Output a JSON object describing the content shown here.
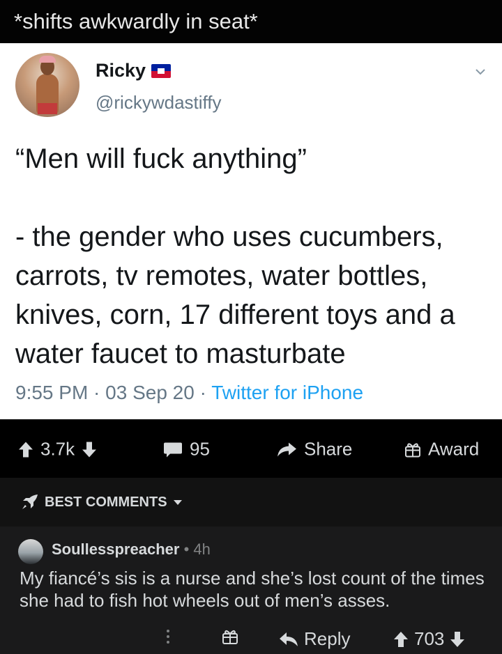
{
  "post": {
    "title": "*shifts awkwardly in seat*"
  },
  "tweet": {
    "name": "Ricky",
    "handle": "@rickywdastiffy",
    "text": "“Men will fuck anything”\n\n- the gender who uses cucumbers, carrots, tv remotes, water bottles, knives, corn, 17 different toys and a water faucet to masturbate",
    "time": "9:55 PM · 03 Sep 20 · ",
    "source": "Twitter for iPhone"
  },
  "actions": {
    "score": "3.7k",
    "comments": "95",
    "share": "Share",
    "award": "Award"
  },
  "best_comments": {
    "label": "BEST COMMENTS"
  },
  "comment": {
    "user": "Soullesspreacher",
    "dot": "•",
    "time": "4h",
    "body": "My fiancé’s sis is a nurse and she’s lost count of the times she  had to fish hot wheels out of men’s asses.",
    "reply": "Reply",
    "score": "703"
  },
  "colors": {
    "accent": "#1da1f2",
    "dark_bg": "#1a1a1b",
    "tweet_bg": "#ffffff"
  }
}
